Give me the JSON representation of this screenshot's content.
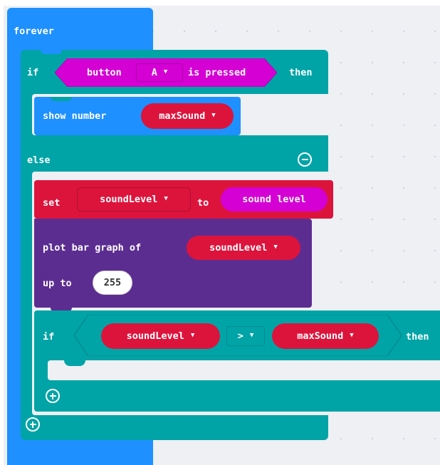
{
  "colors": {
    "loops": "#1e90ff",
    "logic": "#00a4a6",
    "basic": "#1e90ff",
    "variables": "#dc143c",
    "input": "#d400d4",
    "led": "#5c2d91",
    "workspace": "#eef0f4"
  },
  "forever": {
    "label": "forever"
  },
  "if_block": {
    "if_label": "if",
    "then_label": "then",
    "else_label": "else",
    "condition": {
      "button_label": "button",
      "button_value": "A",
      "pressed_label": "is pressed"
    }
  },
  "show_number": {
    "label": "show number",
    "variable": "maxSound"
  },
  "set_block": {
    "set_label": "set",
    "variable": "soundLevel",
    "to_label": "to",
    "value": "sound level"
  },
  "plot_block": {
    "label": "plot bar graph of",
    "variable": "soundLevel",
    "upto_label": "up to",
    "upto_value": "255"
  },
  "inner_if": {
    "if_label": "if",
    "then_label": "then",
    "left": "soundLevel",
    "operator": ">",
    "right": "maxSound"
  },
  "icons": {
    "caret": "▼",
    "remove_else": "minus-circle-icon",
    "add_branch": "plus-circle-icon"
  }
}
